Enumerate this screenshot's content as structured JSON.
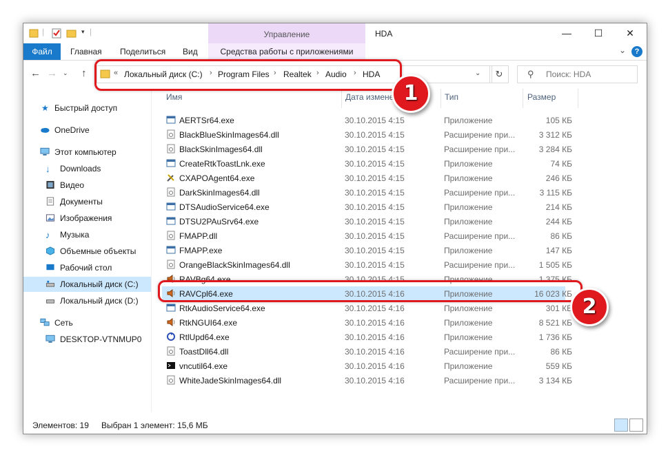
{
  "window": {
    "title": "HDA",
    "context_tab_group": "Управление",
    "controls": {
      "minimize": "—",
      "maximize": "☐",
      "close": "✕"
    }
  },
  "ribbon": {
    "tabs": [
      "Файл",
      "Главная",
      "Поделиться",
      "Вид",
      "Средства работы с приложениями"
    ],
    "help": "?"
  },
  "address": {
    "prefix": "«",
    "crumbs": [
      "Локальный диск (C:)",
      "Program Files",
      "Realtek",
      "Audio",
      "HDA"
    ],
    "separator": "›"
  },
  "search": {
    "placeholder": "Поиск: HDA"
  },
  "sidebar": {
    "items": [
      {
        "label": "Быстрый доступ",
        "icon": "star-icon"
      },
      {
        "label": "OneDrive",
        "icon": "cloud-icon"
      },
      {
        "label": "Этот компьютер",
        "icon": "computer-icon"
      },
      {
        "label": "Downloads",
        "icon": "download-icon"
      },
      {
        "label": "Видео",
        "icon": "video-icon"
      },
      {
        "label": "Документы",
        "icon": "document-icon"
      },
      {
        "label": "Изображения",
        "icon": "image-icon"
      },
      {
        "label": "Музыка",
        "icon": "music-icon"
      },
      {
        "label": "Объемные объекты",
        "icon": "cube-icon"
      },
      {
        "label": "Рабочий стол",
        "icon": "desktop-icon"
      },
      {
        "label": "Локальный диск (C:)",
        "icon": "drive-icon"
      },
      {
        "label": "Локальный диск (D:)",
        "icon": "drive-icon"
      },
      {
        "label": "Сеть",
        "icon": "network-icon"
      },
      {
        "label": "DESKTOP-VTNMUP0",
        "icon": "computer-icon"
      }
    ]
  },
  "columns": {
    "name": "Имя",
    "date": "Дата изменен",
    "type": "Тип",
    "size": "Размер"
  },
  "files": [
    {
      "name": "AERTSr64.exe",
      "date": "30.10.2015 4:15",
      "type": "Приложение",
      "size": "105 КБ",
      "icon": "app-icon"
    },
    {
      "name": "BlackBlueSkinImages64.dll",
      "date": "30.10.2015 4:15",
      "type": "Расширение при...",
      "size": "3 312 КБ",
      "icon": "dll-icon"
    },
    {
      "name": "BlackSkinImages64.dll",
      "date": "30.10.2015 4:15",
      "type": "Расширение при...",
      "size": "3 284 КБ",
      "icon": "dll-icon"
    },
    {
      "name": "CreateRtkToastLnk.exe",
      "date": "30.10.2015 4:15",
      "type": "Приложение",
      "size": "74 КБ",
      "icon": "app-icon"
    },
    {
      "name": "CXAPOAgent64.exe",
      "date": "30.10.2015 4:15",
      "type": "Приложение",
      "size": "246 КБ",
      "icon": "tools-icon"
    },
    {
      "name": "DarkSkinImages64.dll",
      "date": "30.10.2015 4:15",
      "type": "Расширение при...",
      "size": "3 115 КБ",
      "icon": "dll-icon"
    },
    {
      "name": "DTSAudioService64.exe",
      "date": "30.10.2015 4:15",
      "type": "Приложение",
      "size": "214 КБ",
      "icon": "app-icon"
    },
    {
      "name": "DTSU2PAuSrv64.exe",
      "date": "30.10.2015 4:15",
      "type": "Приложение",
      "size": "244 КБ",
      "icon": "app-icon"
    },
    {
      "name": "FMAPP.dll",
      "date": "30.10.2015 4:15",
      "type": "Расширение при...",
      "size": "86 КБ",
      "icon": "dll-icon"
    },
    {
      "name": "FMAPP.exe",
      "date": "30.10.2015 4:15",
      "type": "Приложение",
      "size": "147 КБ",
      "icon": "app-icon"
    },
    {
      "name": "OrangeBlackSkinImages64.dll",
      "date": "30.10.2015 4:15",
      "type": "Расширение при...",
      "size": "1 505 КБ",
      "icon": "dll-icon"
    },
    {
      "name": "RAVBg64.exe",
      "date": "30.10.2015 4:15",
      "type": "Приложение",
      "size": "1 375 КБ",
      "icon": "speaker-icon"
    },
    {
      "name": "RAVCpl64.exe",
      "date": "30.10.2015 4:16",
      "type": "Приложение",
      "size": "16 023 КБ",
      "icon": "speaker-icon"
    },
    {
      "name": "RtkAudioService64.exe",
      "date": "30.10.2015 4:16",
      "type": "Приложение",
      "size": "301 КБ",
      "icon": "app-icon"
    },
    {
      "name": "RtkNGUI64.exe",
      "date": "30.10.2015 4:16",
      "type": "Приложение",
      "size": "8 521 КБ",
      "icon": "speaker-icon"
    },
    {
      "name": "RtlUpd64.exe",
      "date": "30.10.2015 4:16",
      "type": "Приложение",
      "size": "1 736 КБ",
      "icon": "update-icon"
    },
    {
      "name": "ToastDll64.dll",
      "date": "30.10.2015 4:16",
      "type": "Расширение при...",
      "size": "86 КБ",
      "icon": "dll-icon"
    },
    {
      "name": "vncutil64.exe",
      "date": "30.10.2015 4:16",
      "type": "Приложение",
      "size": "559 КБ",
      "icon": "console-icon"
    },
    {
      "name": "WhiteJadeSkinImages64.dll",
      "date": "30.10.2015 4:16",
      "type": "Расширение при...",
      "size": "3 134 КБ",
      "icon": "dll-icon"
    }
  ],
  "selected_file": "RAVCpl64.exe",
  "status": {
    "count": "Элементов: 19",
    "selected": "Выбран 1 элемент: 15,6 МБ"
  },
  "annotations": {
    "badge1": "1",
    "badge2": "2",
    "color": "#e0191f"
  },
  "colors": {
    "selection": "#cce8ff",
    "accent": "#1979ca",
    "context_tab": "#ecd9f8"
  }
}
